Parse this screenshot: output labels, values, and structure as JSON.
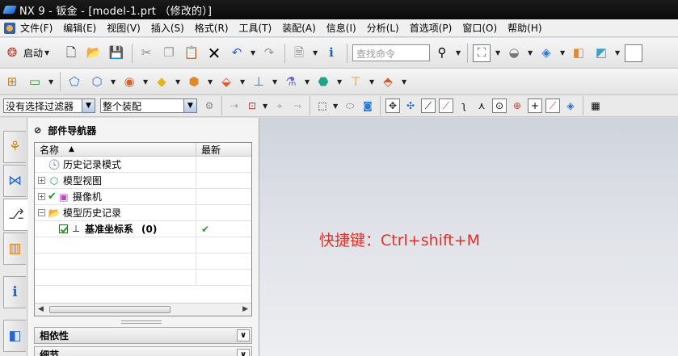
{
  "window": {
    "title": "NX 9 - 钣金 - [model-1.prt （修改的）]"
  },
  "menu": [
    "文件(F)",
    "编辑(E)",
    "视图(V)",
    "插入(S)",
    "格式(R)",
    "工具(T)",
    "装配(A)",
    "信息(I)",
    "分析(L)",
    "首选项(P)",
    "窗口(O)",
    "帮助(H)"
  ],
  "toolbar": {
    "start_label": "启动",
    "search_placeholder": "查找命令"
  },
  "selection_bar": {
    "filter_value": "没有选择过滤器",
    "scope_value": "整个装配"
  },
  "navigator": {
    "title": "部件导航器",
    "columns": {
      "name": "名称",
      "latest": "最新"
    },
    "rows": [
      {
        "label": "历史记录模式",
        "icon": "clock-icon"
      },
      {
        "label": "模型视图",
        "icon": "model-view-icon"
      },
      {
        "label": "摄像机",
        "icon": "camera-icon"
      },
      {
        "label": "模型历史记录",
        "icon": "folder-icon"
      },
      {
        "label": "基准坐标系",
        "count": "(0)",
        "latest": "✔",
        "icon": "datum-csys-icon"
      }
    ],
    "panels": {
      "dependency": "相依性",
      "details": "细节"
    }
  },
  "graphics": {
    "annotation": "快捷键：Ctrl+shift+M"
  },
  "colors": {
    "annotation": "#e0322a",
    "check_green": "#1e9a1e"
  }
}
